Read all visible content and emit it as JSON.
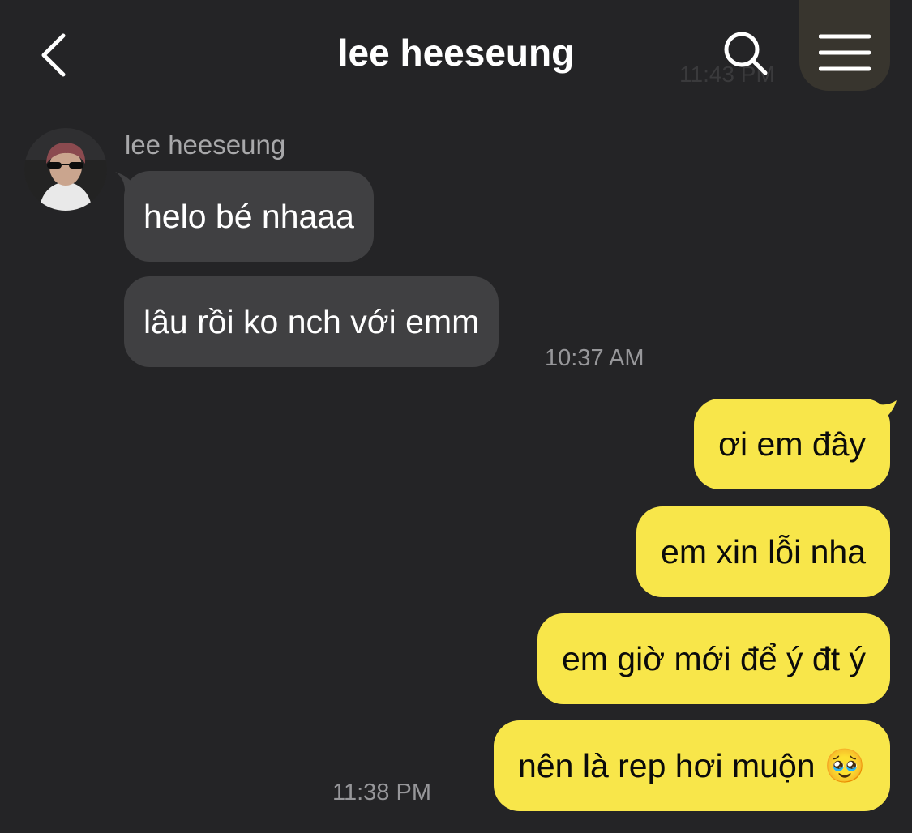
{
  "header": {
    "title": "lee heeseung",
    "ghost_time": "11:43 PM"
  },
  "icons": {
    "back": "chevron-left-icon",
    "search": "search-icon",
    "menu": "hamburger-menu-icon"
  },
  "colors": {
    "background": "#242426",
    "incoming_bubble": "#404042",
    "outgoing_bubble": "#f8e64a",
    "timestamp": "#97979a"
  },
  "conversation": {
    "sender_name": "lee heeseung",
    "incoming": [
      {
        "text": "helo bé nhaaa"
      },
      {
        "text": "lâu rồi ko nch với emm"
      }
    ],
    "incoming_time": "10:37 AM",
    "outgoing": [
      {
        "text": "ơi em đây"
      },
      {
        "text": "em xin lỗi nha"
      },
      {
        "text": "em giờ mới để ý đt ý"
      },
      {
        "text": "nên là rep hơi muộn 🥹"
      }
    ],
    "outgoing_time": "11:38 PM"
  }
}
